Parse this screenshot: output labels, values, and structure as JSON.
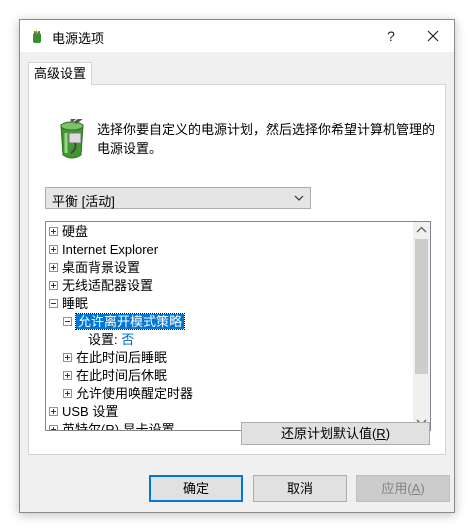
{
  "window": {
    "title": "电源选项",
    "help_label": "?",
    "icon": "power-options-icon"
  },
  "tab": {
    "label": "高级设置"
  },
  "description": "选择你要自定义的电源计划，然后选择你希望计算机管理的电源设置。",
  "plan_select": {
    "value": "平衡 [活动]"
  },
  "tree": {
    "items": [
      {
        "label": "硬盘",
        "state": "collapsed"
      },
      {
        "label": "Internet Explorer",
        "state": "collapsed"
      },
      {
        "label": "桌面背景设置",
        "state": "collapsed"
      },
      {
        "label": "无线适配器设置",
        "state": "collapsed"
      },
      {
        "label": "睡眠",
        "state": "expanded"
      },
      {
        "label": "允许离开模式策略",
        "state": "expanded",
        "selected": true
      },
      {
        "label": "设置:",
        "value": "否"
      },
      {
        "label": "在此时间后睡眠",
        "state": "collapsed"
      },
      {
        "label": "在此时间后休眠",
        "state": "collapsed"
      },
      {
        "label": "允许使用唤醒定时器",
        "state": "collapsed"
      },
      {
        "label": "USB 设置",
        "state": "collapsed"
      },
      {
        "label": "英特尔(R) 显卡设置",
        "state": "collapsed"
      }
    ]
  },
  "buttons": {
    "restore": {
      "text": "还原计划默认值(",
      "key": "R",
      "suffix": ")"
    },
    "ok": "确定",
    "cancel": "取消",
    "apply": {
      "text": "应用(",
      "key": "A",
      "suffix": ")"
    }
  },
  "colors": {
    "accent": "#0078d7",
    "value_text": "#0066cc"
  }
}
